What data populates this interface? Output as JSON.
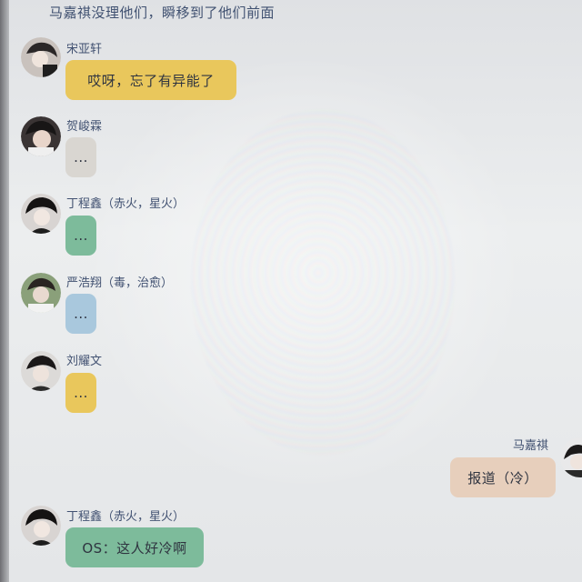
{
  "narration": "马嘉祺没理他们，瞬移到了他们前面",
  "messages": [
    {
      "sender": "宋亚轩",
      "text": "哎呀，忘了有异能了",
      "color": "#e9c75c",
      "side": "left"
    },
    {
      "sender": "贺峻霖",
      "text": "...",
      "color": "#d9d6d1",
      "side": "left"
    },
    {
      "sender": "丁程鑫（赤火，星火）",
      "text": "...",
      "color": "#7dbb9b",
      "side": "left"
    },
    {
      "sender": "严浩翔（毒，治愈）",
      "text": "...",
      "color": "#a9c8dd",
      "side": "left"
    },
    {
      "sender": "刘耀文",
      "text": "...",
      "color": "#e9c75c",
      "side": "left"
    },
    {
      "sender": "马嘉祺",
      "text": "报道（冷）",
      "color": "#e7cfbc",
      "side": "right"
    },
    {
      "sender": "丁程鑫（赤火，星火）",
      "text": "OS：这人好冷啊",
      "color": "#7dbb9b",
      "side": "left"
    }
  ]
}
